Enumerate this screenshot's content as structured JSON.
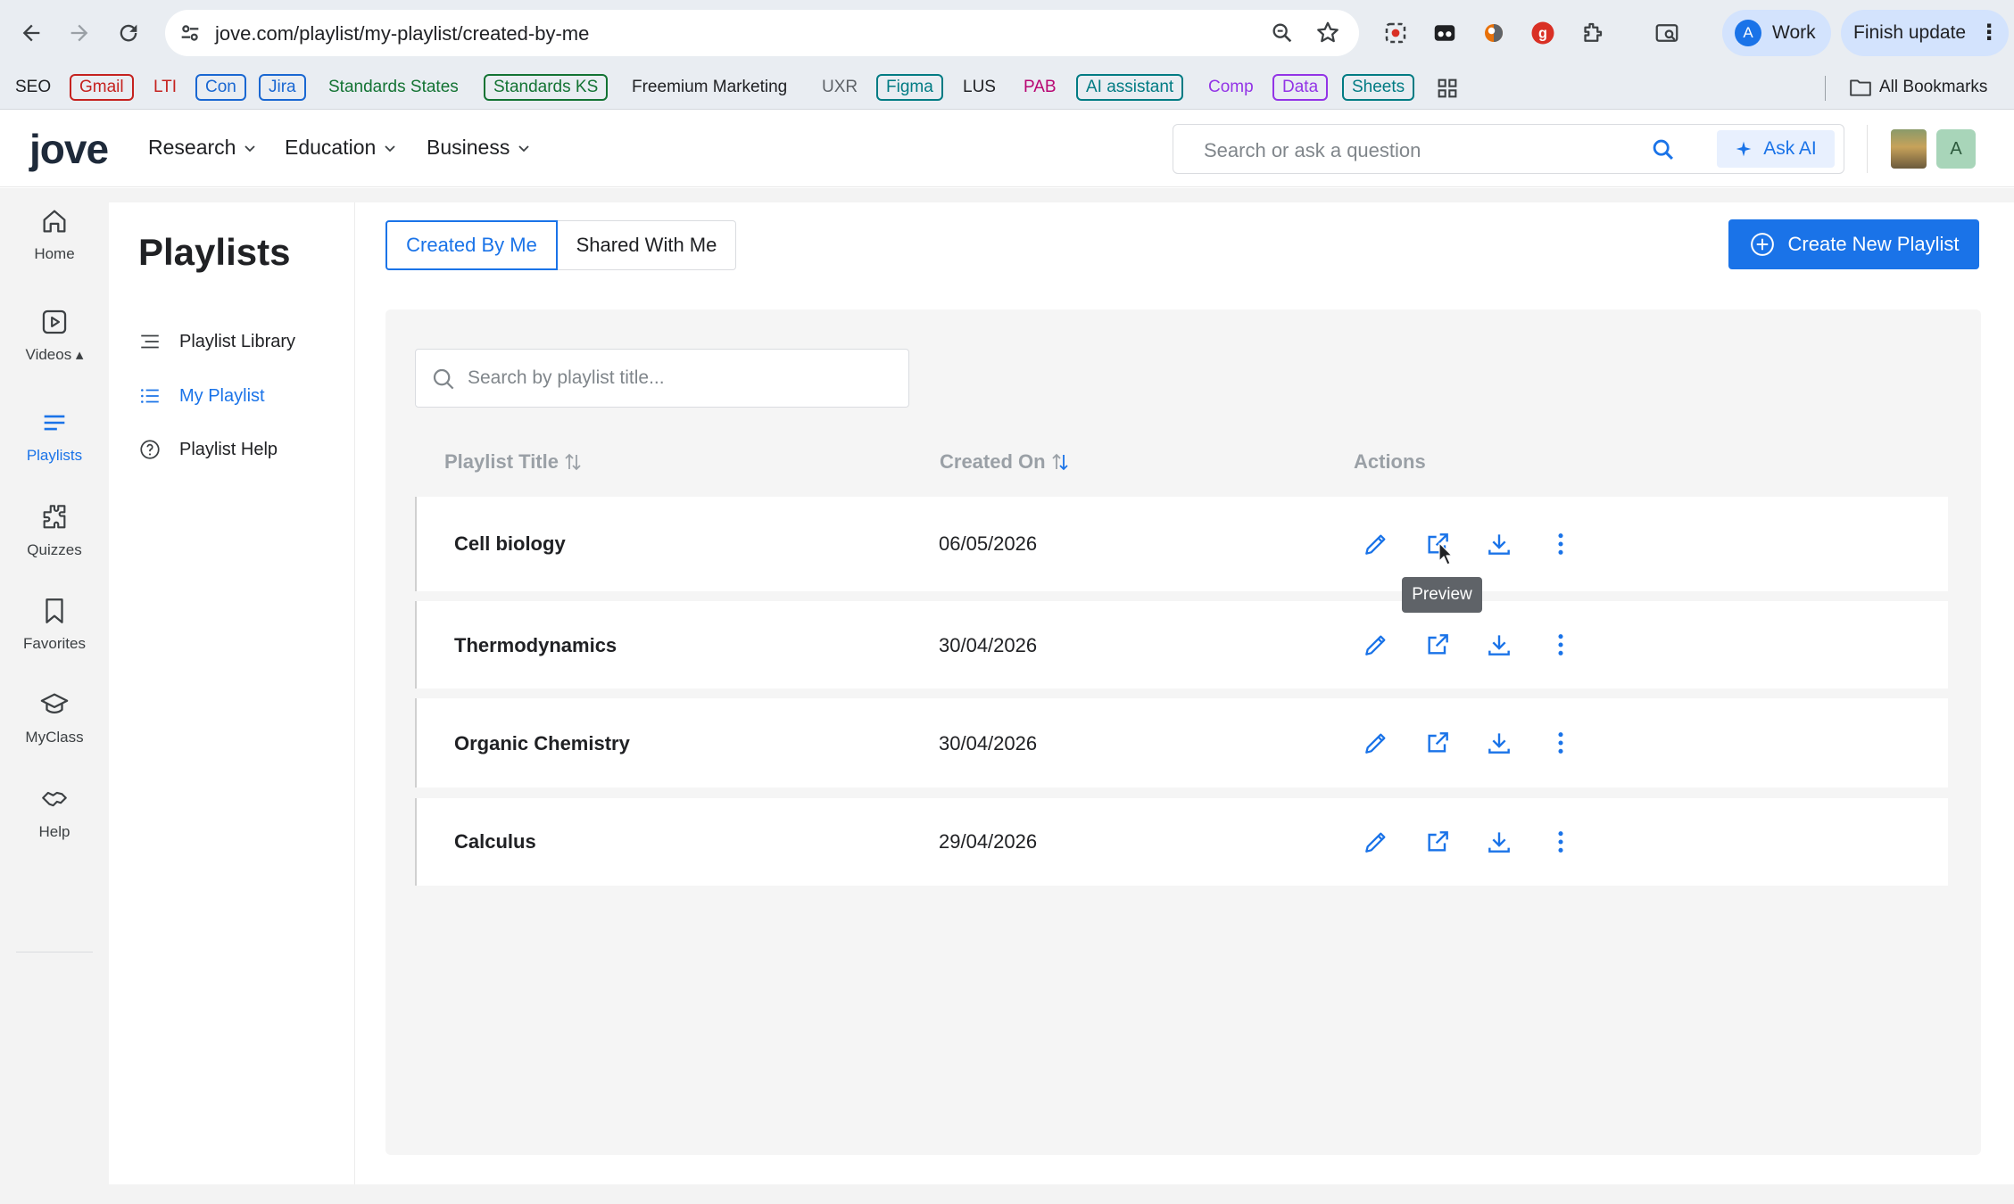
{
  "browser": {
    "url": "jove.com/playlist/my-playlist/created-by-me",
    "profile_label": "Work",
    "profile_initial": "A",
    "update_label": "Finish update",
    "bookmarks": [
      {
        "label": "SEO",
        "color": "#202124",
        "border": "transparent"
      },
      {
        "label": "Gmail",
        "color": "#c5221f",
        "border": "#c5221f"
      },
      {
        "label": "LTI",
        "color": "#c5221f",
        "border": "transparent"
      },
      {
        "label": "Con",
        "color": "#1967d2",
        "border": "#1967d2"
      },
      {
        "label": "Jira",
        "color": "#1967d2",
        "border": "#1967d2"
      },
      {
        "label": "Standards States",
        "color": "#137333",
        "border": "transparent"
      },
      {
        "label": "Standards KS",
        "color": "#137333",
        "border": "#137333"
      },
      {
        "label": "Freemium Marketing",
        "color": "#202124",
        "border": "transparent"
      },
      {
        "label": "UXR",
        "color": "#5f6368",
        "border": "transparent"
      },
      {
        "label": "Figma",
        "color": "#007b83",
        "border": "#007b83"
      },
      {
        "label": "LUS",
        "color": "#202124",
        "border": "transparent"
      },
      {
        "label": "PAB",
        "color": "#b80672",
        "border": "transparent"
      },
      {
        "label": "AI assistant",
        "color": "#007b83",
        "border": "#007b83"
      },
      {
        "label": "Comp",
        "color": "#9334e6",
        "border": "transparent"
      },
      {
        "label": "Data",
        "color": "#9334e6",
        "border": "#9334e6"
      },
      {
        "label": "Sheets",
        "color": "#007b83",
        "border": "#007b83"
      }
    ],
    "all_bookmarks_label": "All Bookmarks"
  },
  "header": {
    "logo_text": "jove",
    "nav": [
      "Research",
      "Education",
      "Business"
    ],
    "search_placeholder": "Search or ask a question",
    "ask_ai_label": "Ask AI",
    "user_initial": "A"
  },
  "rail": {
    "items": [
      {
        "label": "Home",
        "icon": "home-icon"
      },
      {
        "label": "Videos ▴",
        "icon": "video-icon"
      },
      {
        "label": "Playlists",
        "icon": "playlist-icon",
        "active": true
      },
      {
        "label": "Quizzes",
        "icon": "puzzle-icon"
      },
      {
        "label": "Favorites",
        "icon": "bookmark-icon"
      },
      {
        "label": "MyClass",
        "icon": "graduation-cap-icon"
      },
      {
        "label": "Help",
        "icon": "handshake-icon"
      }
    ]
  },
  "sidebar": {
    "title": "Playlists",
    "items": [
      {
        "label": "Playlist Library",
        "icon": "library-icon"
      },
      {
        "label": "My Playlist",
        "icon": "list-icon",
        "active": true
      },
      {
        "label": "Playlist Help",
        "icon": "question-circle-icon"
      }
    ]
  },
  "main": {
    "tabs": [
      {
        "label": "Created By Me",
        "active": true
      },
      {
        "label": "Shared With Me",
        "active": false
      }
    ],
    "create_button_label": "Create New Playlist",
    "search_placeholder": "Search by playlist title...",
    "columns": {
      "title": "Playlist Title",
      "created": "Created On",
      "actions": "Actions"
    },
    "rows": [
      {
        "title": "Cell biology",
        "date": "06/05/2026"
      },
      {
        "title": "Thermodynamics",
        "date": "30/04/2026"
      },
      {
        "title": "Organic Chemistry",
        "date": "30/04/2026"
      },
      {
        "title": "Calculus",
        "date": "29/04/2026"
      }
    ],
    "tooltip": "Preview",
    "accent_color": "#1a73e8"
  }
}
